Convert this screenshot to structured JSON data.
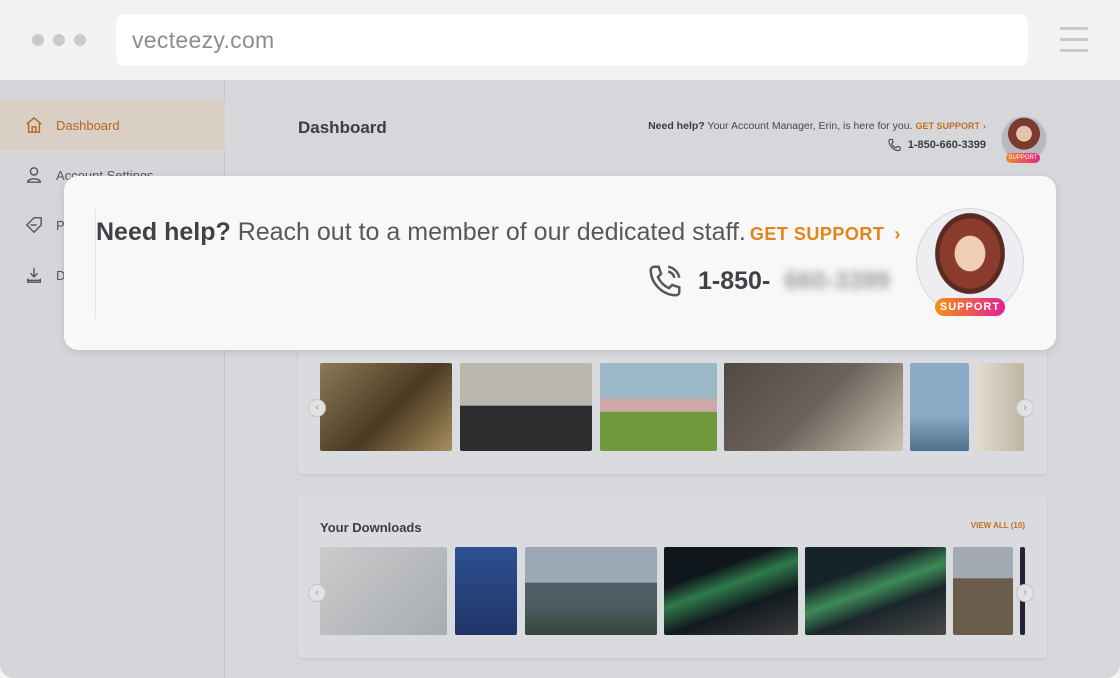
{
  "browser": {
    "url": "vecteezy.com"
  },
  "sidebar": {
    "items": [
      {
        "label": "Dashboard",
        "icon": "home-icon",
        "active": true
      },
      {
        "label": "Account Settings",
        "icon": "user-icon"
      },
      {
        "label": "P",
        "icon": "tag-icon"
      },
      {
        "label": "D",
        "icon": "download-icon"
      }
    ]
  },
  "header": {
    "title": "Dashboard",
    "help_bold": "Need help?",
    "help_text": " Your Account Manager, Erin, is here for you.",
    "get_support": "GET SUPPORT",
    "chevron": "›",
    "phone": "1-850-660-3399",
    "avatar_badge": "SUPPORT"
  },
  "downloads": {
    "title": "Your Downloads",
    "view_all": "VIEW ALL (10)"
  },
  "popup": {
    "help_bold": "Need help?",
    "help_text": " Reach out to a member of our dedicated staff.",
    "get_support": "GET SUPPORT",
    "chevron": "›",
    "phone_visible": "1-850-",
    "phone_blurred": "660-3399",
    "avatar_badge": "SUPPORT"
  },
  "colors": {
    "accent": "#e28417",
    "badge_gradient_start": "#f39217",
    "badge_gradient_end": "#e41f93"
  }
}
